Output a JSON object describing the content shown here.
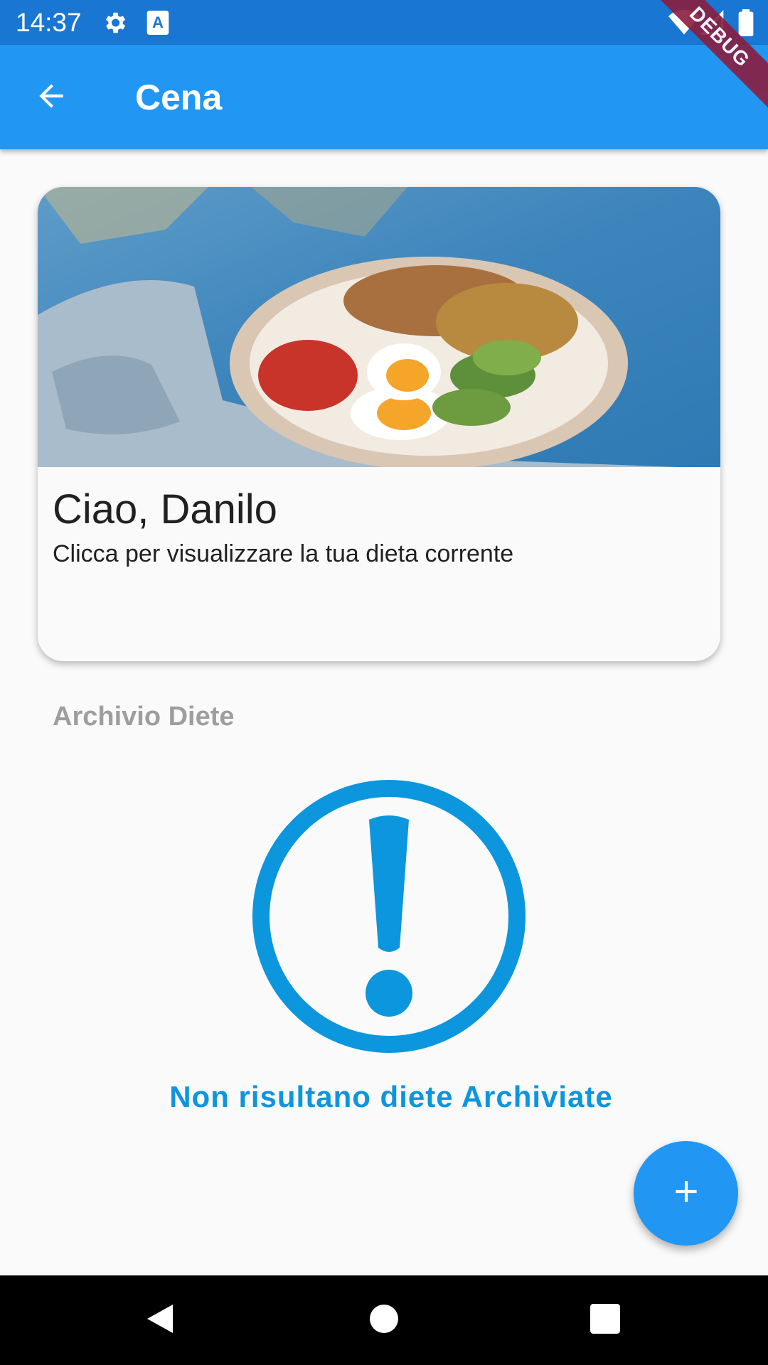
{
  "status_bar": {
    "time": "14:37",
    "icons": [
      "gear-icon",
      "a-icon",
      "wifi-icon",
      "signal-icon",
      "battery-icon"
    ],
    "background": "#1976D2"
  },
  "app_bar": {
    "title": "Cena",
    "back_icon": "arrow-left-icon",
    "background": "#2196F3"
  },
  "debug_banner": {
    "label": "DEBUG"
  },
  "card": {
    "image": "food-bowl-photo",
    "title": "Ciao, Danilo",
    "subtitle": "Clicca per visualizzare la tua dieta corrente"
  },
  "archive": {
    "title": "Archivio Diete",
    "empty_icon": "exclamation-circle-icon",
    "empty_text": "Non risultano diete Archiviate",
    "accent": "#0B96DD"
  },
  "fab": {
    "icon": "plus-icon",
    "background": "#2196F3"
  },
  "nav_bar": {
    "icons": [
      "back-triangle-icon",
      "home-circle-icon",
      "recents-square-icon"
    ]
  }
}
